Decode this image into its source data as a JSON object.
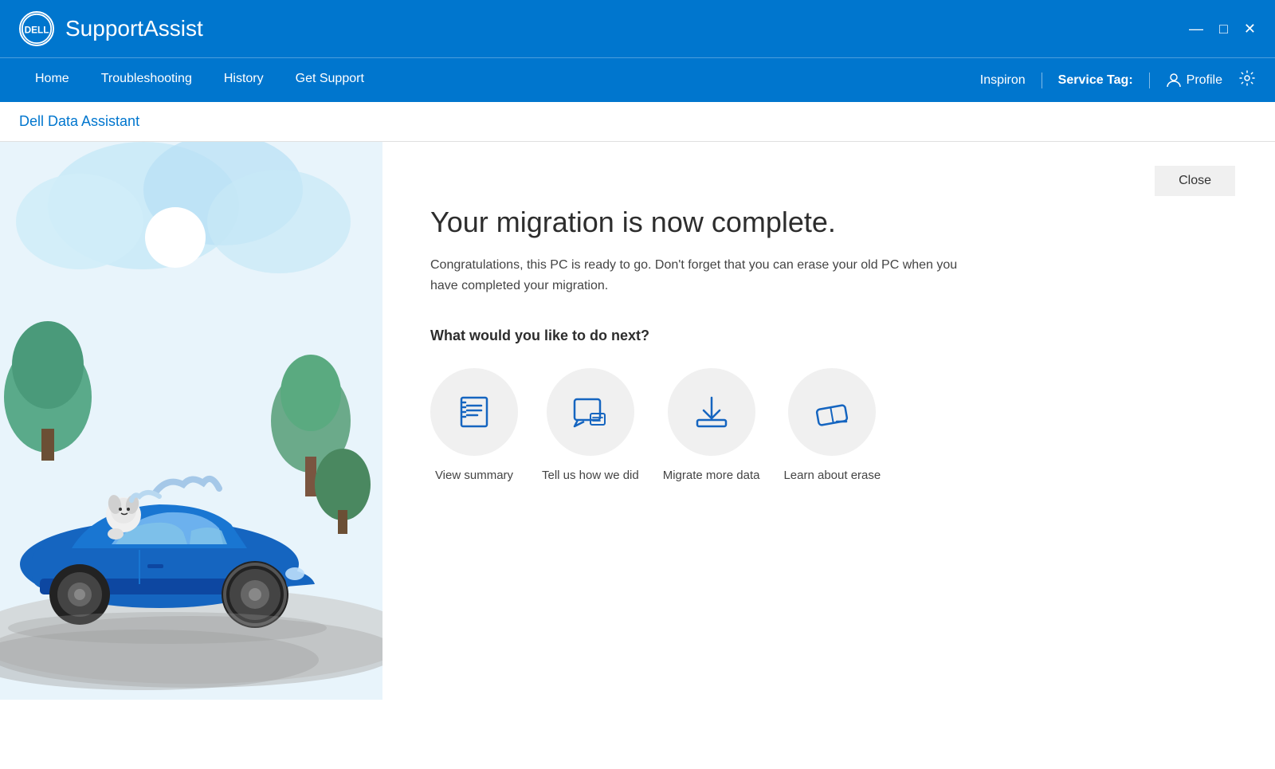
{
  "titlebar": {
    "logo": "DELL",
    "app_title": "SupportAssist",
    "minimize": "—",
    "maximize": "□",
    "close": "✕"
  },
  "navbar": {
    "items": [
      {
        "label": "Home",
        "id": "home"
      },
      {
        "label": "Troubleshooting",
        "id": "troubleshooting"
      },
      {
        "label": "History",
        "id": "history"
      },
      {
        "label": "Get Support",
        "id": "get-support"
      }
    ],
    "device": "Inspiron",
    "service_tag_label": "Service Tag:",
    "service_tag_value": "",
    "profile_label": "Profile"
  },
  "sub_header": {
    "title": "Dell Data Assistant"
  },
  "main": {
    "close_label": "Close",
    "migration_title": "Your migration is now complete.",
    "migration_desc": "Congratulations, this PC is ready to go. Don't forget that you can erase your old PC when you have completed your migration.",
    "next_label": "What would you like to do next?",
    "actions": [
      {
        "id": "view-summary",
        "label": "View summary",
        "icon": "list"
      },
      {
        "id": "tell-us",
        "label": "Tell us how we did",
        "icon": "feedback"
      },
      {
        "id": "migrate-more",
        "label": "Migrate more data",
        "icon": "download"
      },
      {
        "id": "learn-erase",
        "label": "Learn about erase",
        "icon": "eraser"
      }
    ]
  }
}
